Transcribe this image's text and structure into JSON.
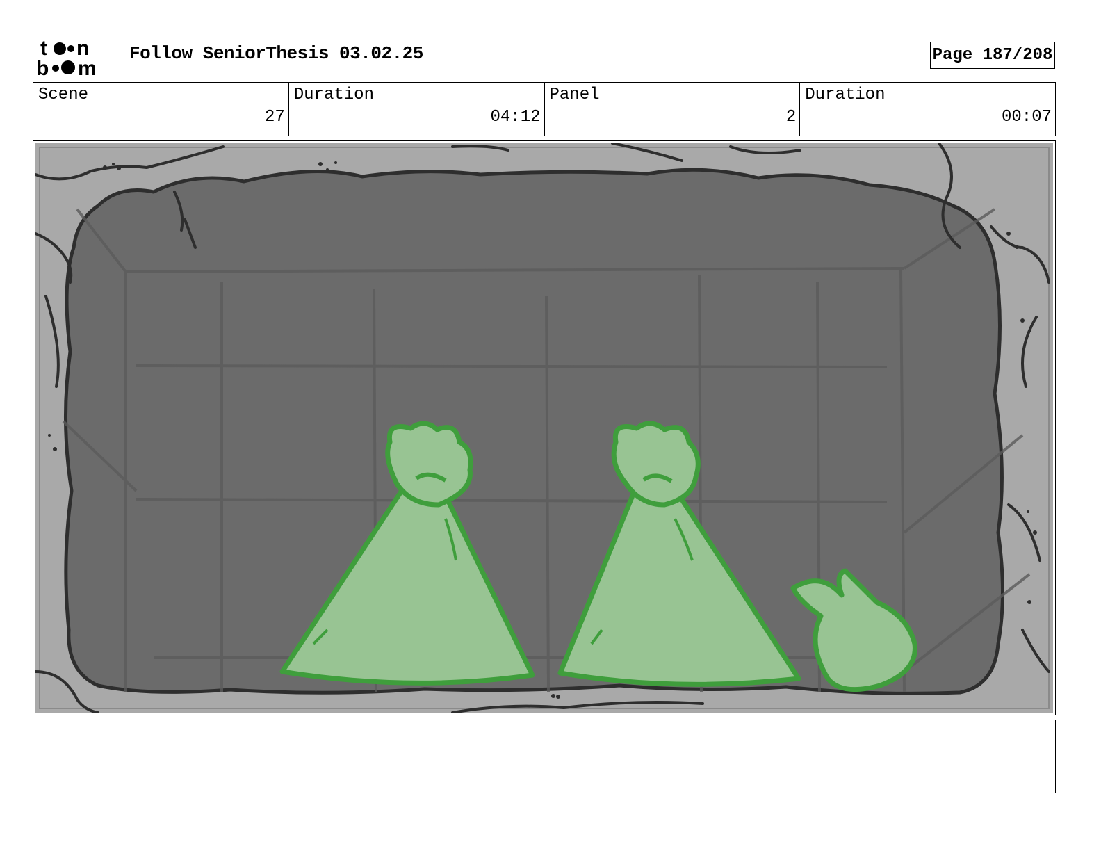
{
  "header": {
    "logo_alt": "toon boom",
    "document_title": "Follow SeniorThesis 03.02.25",
    "page_indicator": "Page 187/208"
  },
  "info_fields": [
    {
      "label": "Scene",
      "value": "27"
    },
    {
      "label": "Duration",
      "value": "04:12"
    },
    {
      "label": "Panel",
      "value": "2"
    },
    {
      "label": "Duration",
      "value": "00:07"
    }
  ],
  "panel": {
    "colors": {
      "border_stone": "#a9a9a9",
      "interior": "#6b6b6b",
      "outline": "#2e2e2e",
      "figure_fill": "#98c493",
      "figure_line": "#3f9e3c"
    }
  },
  "notes": {
    "text": ""
  }
}
